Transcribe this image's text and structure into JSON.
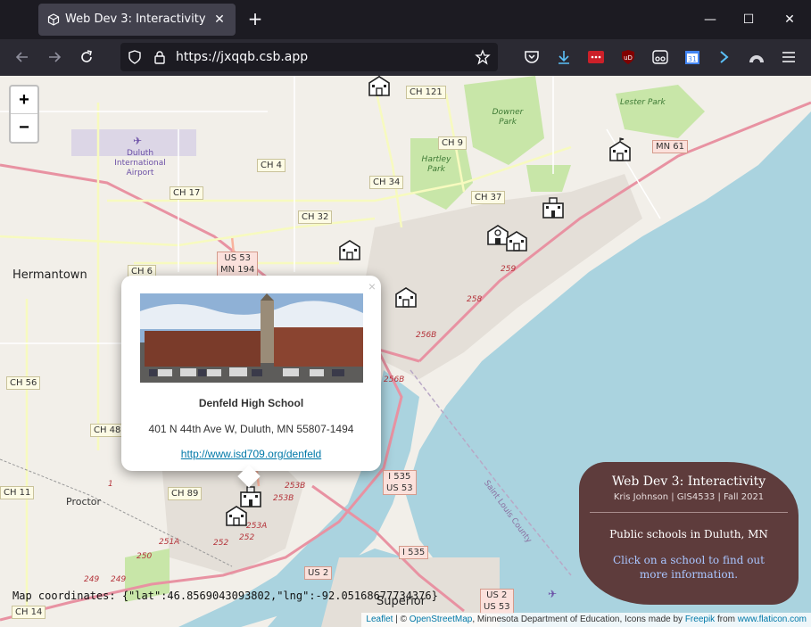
{
  "browser": {
    "tab_title": "Web Dev 3: Interactivity",
    "url": "https://jxqqb.csb.app",
    "tab_close": "✕",
    "new_tab": "+",
    "minimize": "—",
    "maximize": "☐",
    "close": "✕"
  },
  "map": {
    "zoom_in": "+",
    "zoom_out": "−",
    "places": {
      "hermantown": "Hermantown",
      "superior": "Superior",
      "proctor": "Proctor"
    },
    "airport": [
      "Duluth",
      "International",
      "Airport"
    ],
    "parks": {
      "downer": [
        "Downer",
        "Park"
      ],
      "hartley": [
        "Hartley",
        "Park"
      ],
      "lester": "Lester Park"
    },
    "water_label": "Saint Louis County",
    "shields": {
      "ch121": "CH 121",
      "ch9": "CH 9",
      "ch4": "CH 4",
      "ch34": "CH 34",
      "ch17": "CH 17",
      "ch37": "CH 37",
      "ch32": "CH 32",
      "ch6": "CH 6",
      "ch56": "CH 56",
      "ch48": "CH 48",
      "ch89": "CH 89",
      "ch11": "CH 11",
      "ch14": "CH 14",
      "us53a": "US 53",
      "mn194": "MN 194",
      "mn61": "MN 61",
      "i535a": "I 535",
      "us53b": "US 53",
      "i535b": "I 535",
      "us2a": "US 2",
      "us2b": "US 2",
      "us53c": "US 53"
    },
    "exits": [
      "259",
      "258",
      "256B",
      "256B",
      "253B",
      "253B",
      "253A",
      "251A",
      "252",
      "252",
      "250",
      "249",
      "249",
      "1"
    ],
    "coordinates_text": "Map coordinates: {\"lat\":46.8569043093802,\"lng\":-92.05168677734376}",
    "attribution": {
      "leaflet": "Leaflet",
      "sep1": " | © ",
      "osm": "OpenStreetMap",
      "mid": ", Minnesota Department of Education, Icons made by ",
      "freepik": "Freepik",
      "from": " from ",
      "flaticon": "www.flaticon.com"
    }
  },
  "popup": {
    "close": "×",
    "school_name": "Denfeld High School",
    "address": "401 N 44th Ave W, Duluth, MN 55807-1494",
    "link": "http://www.isd709.org/denfeld"
  },
  "infobox": {
    "title": "Web Dev 3: Interactivity",
    "subtitle": "Kris Johnson | GIS4533 | Fall 2021",
    "description": "Public schools in Duluth, MN",
    "cta": "Click on a school to find out more information."
  },
  "colors": {
    "water": "#aad3df",
    "land": "#f2efe9",
    "park": "#c8e6a8",
    "infobox": "#5e3c3c",
    "link": "#0078a8"
  }
}
